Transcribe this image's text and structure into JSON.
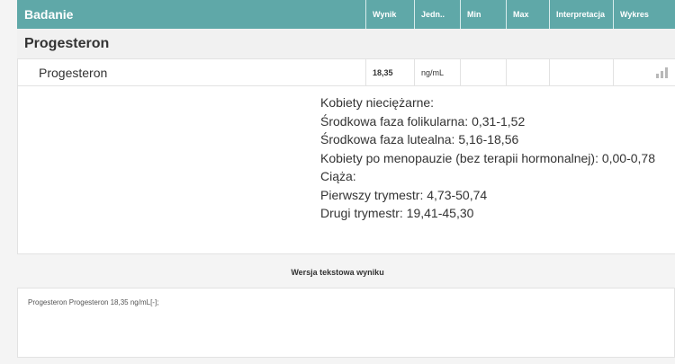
{
  "header": {
    "badanie": "Badanie",
    "wynik": "Wynik",
    "jedn": "Jedn..",
    "min": "Min",
    "max": "Max",
    "interpretacja": "Interpretacja",
    "wykres": "Wykres"
  },
  "group": {
    "title": "Progesteron"
  },
  "row": {
    "name": "Progesteron",
    "wynik": "18,35",
    "jedn": "ng/mL",
    "min": "",
    "max": "",
    "interpretacja": "",
    "chart_icon": "bar-chart-icon"
  },
  "description": [
    "Kobiety nieciężarne:",
    "Środkowa faza folikularna: 0,31-1,52",
    "Środkowa faza lutealna: 5,16-18,56",
    "Kobiety po menopauzie (bez terapii hormonalnej): 0,00-0,78",
    "Ciąża:",
    "Pierwszy trymestr: 4,73-50,74",
    "Drugi trymestr: 19,41-45,30"
  ],
  "text_version": {
    "title": "Wersja tekstowa wyniku",
    "content": "Progesteron Progesteron 18,35 ng/mL[-];"
  },
  "colors": {
    "header_bg": "#5fa8a8",
    "header_text": "#ffffff"
  }
}
